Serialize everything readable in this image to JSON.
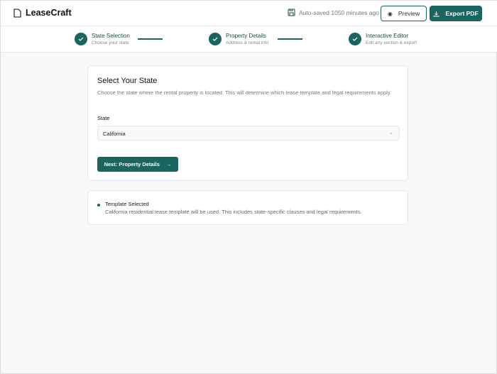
{
  "header": {
    "app_name": "LeaseCraft",
    "autosave": "Auto-saved 1050 minutes ago",
    "preview_label": "Preview",
    "export_label": "Export PDF"
  },
  "steps": [
    {
      "title": "State Selection",
      "subtitle": "Choose your state"
    },
    {
      "title": "Property Details",
      "subtitle": "Address & rental info"
    },
    {
      "title": "Interactive Editor",
      "subtitle": "Edit any section & export"
    }
  ],
  "state_card": {
    "title": "Select Your State",
    "description": "Choose the state where the rental property is located. This will determine which lease template and legal requirements apply.",
    "label": "State",
    "selected": "California",
    "next_label": "Next: Property Details"
  },
  "template_card": {
    "title": "Template Selected",
    "description": "California residential lease template will be used. This includes state-specific clauses and legal requirements."
  },
  "colors": {
    "accent": "#1b6560"
  }
}
